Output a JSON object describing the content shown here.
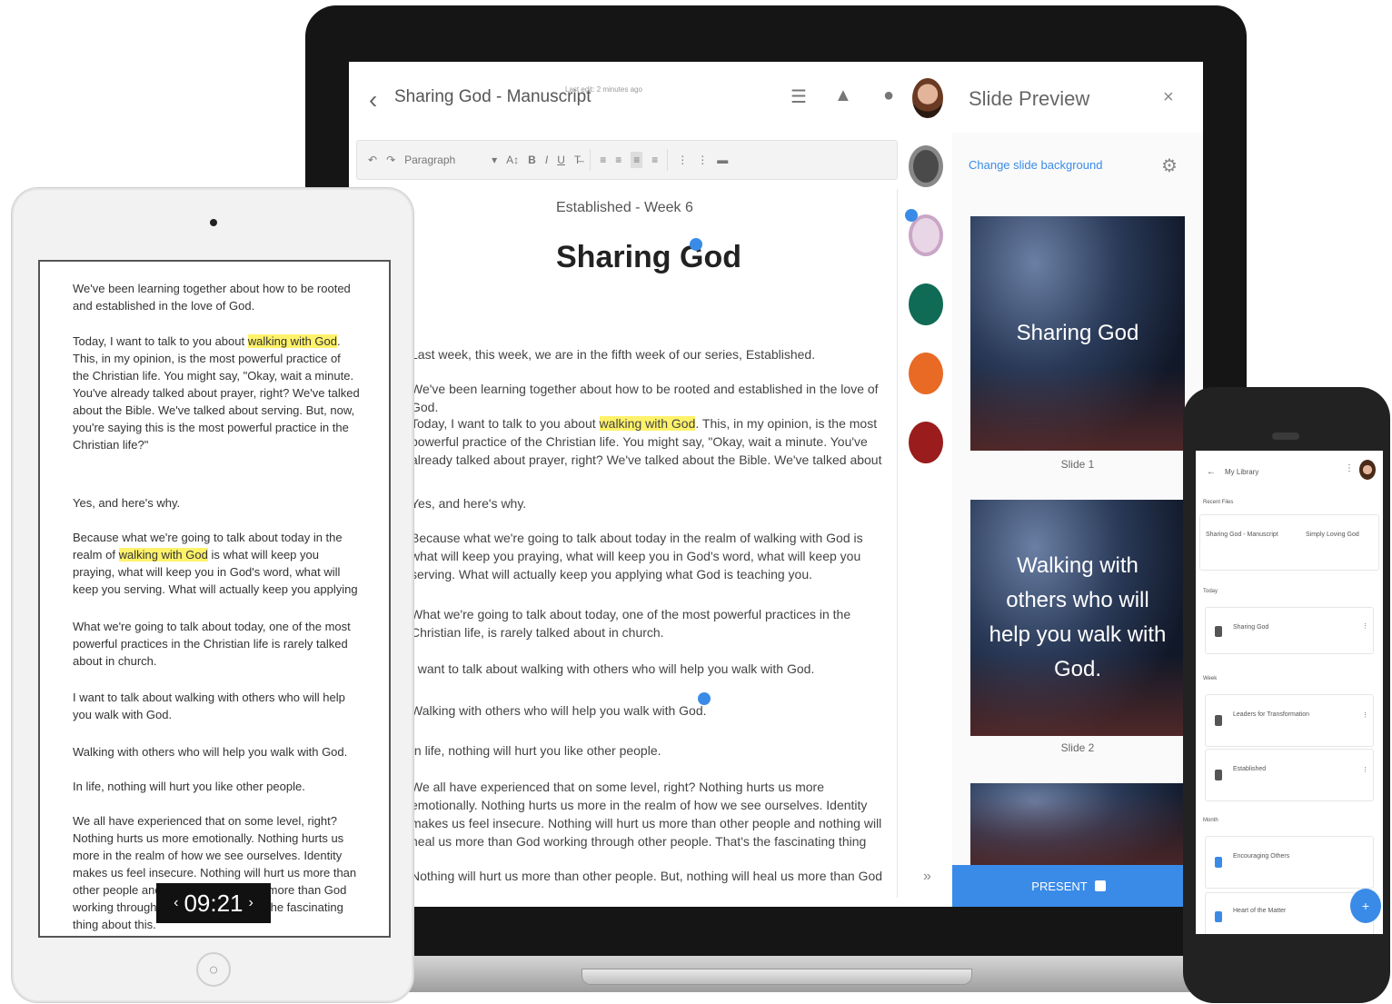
{
  "laptop": {
    "doc_title": "Sharing God - Manuscript",
    "doc_subtitle": "Last edit: 2 minutes ago",
    "panel_title": "Slide Preview",
    "panel_close": "×",
    "change_bg_link": "Change slide background",
    "toolbar": {
      "undo": "↶",
      "redo": "↷",
      "style_select": "Paragraph",
      "font_size": "A↕",
      "bold": "B",
      "italic": "I",
      "underline": "U",
      "clear_format": "T̶"
    },
    "editor": {
      "series": "Established - Week 6",
      "title": "Sharing God",
      "paragraphs": [
        "Last week, this week, we are in the fifth week of our series, Established.",
        "We've been learning together about how to be rooted and established in the love of God.",
        "Today, I want to talk to you about walking with God. This, in my opinion, is the most powerful practice of the Christian life. You might say, \"Okay, wait a minute. You've already talked about prayer, right? We've talked about the Bible. We've talked about serving. But, now, you're saying this is the most powerful practice in the Christian life?\"",
        "Yes, and here's why.",
        "Because what we're going to talk about today in the realm of walking with God is what will keep you praying, what will keep you in God's word, what will keep you serving. What will actually keep you applying what God is teaching you.",
        "What we're going to talk about today, one of the most powerful practices in the Christian life, is rarely talked about in church.",
        "I want to talk about walking with others who will help you walk with God.",
        "Walking with others who will help you walk with God.",
        "In life, nothing will hurt you like other people.",
        "We all have experienced that on some level, right? Nothing hurts us more emotionally. Nothing hurts us more in the realm of how we see ourselves. Identity makes us feel insecure. Nothing will hurt us more than other people and nothing will heal us more than God working through other people. That's the fascinating thing about this.",
        "Nothing will hurt us more than other people. But, nothing will heal us more than God working"
      ],
      "highlight": "walking with God"
    },
    "slides": [
      {
        "text": "Sharing God",
        "caption": "Slide 1"
      },
      {
        "text": "Walking with others who will help you walk with God.",
        "caption": "Slide 2"
      },
      {
        "text": "",
        "caption": ""
      }
    ],
    "present_label": "PRESENT"
  },
  "tablet": {
    "paragraphs": [
      "We've been learning together about how to be rooted and established in the love of God.",
      "Today, I want to talk to you about walking with God. This, in my opinion, is the most powerful practice of the Christian life. You might say, \"Okay, wait a minute. You've already talked about prayer, right? We've talked about the Bible. We've talked about serving. But, now, you're saying this is the most powerful practice in the Christian life?\"",
      "Yes, and here's why.",
      "Because what we're going to talk about today in the realm of walking with God is what will keep you praying, what will keep you in God's word, what will keep you serving. What will actually keep you applying what God is teaching you.",
      "What we're going to talk about today, one of the most powerful practices in the Christian life is rarely talked about in church.",
      "I want to talk about walking with others who will help you walk with God.",
      "Walking with others who will help you walk with God.",
      "In life, nothing will hurt you like other people.",
      "We all have experienced that on some level, right? Nothing hurts us more emotionally. Nothing hurts us more in the realm of how we see ourselves. Identity makes us feel insecure. Nothing will hurt us more than other people and nothing will heal us more than God working through other people. That's the fascinating thing about this."
    ],
    "timer": "09:21",
    "timer_prev": "‹",
    "timer_next": "›"
  },
  "phone": {
    "header": "My Library",
    "section_recent": "Recent Files",
    "recent": [
      "Sharing God - Manuscript",
      "Simply Loving God"
    ],
    "section_a": "Today",
    "items_a": [
      "Sharing God"
    ],
    "section_b": "Week",
    "items_b": [
      "Leaders for Transformation",
      "Established"
    ],
    "section_c": "Month",
    "items_c": [
      "Encouraging Others",
      "Heart of the Matter"
    ]
  }
}
